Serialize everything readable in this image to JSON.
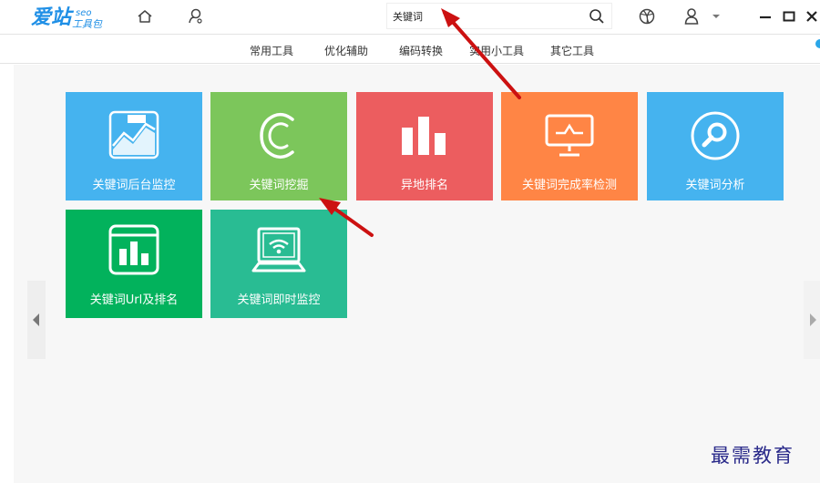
{
  "app": {
    "logo_main": "爱站",
    "logo_seo": "seo",
    "logo_tool": "工具包",
    "brand_color": "#1f8fe6"
  },
  "topbar": {
    "icons": [
      "home-icon",
      "user-location-icon",
      "basketball-icon",
      "user-icon",
      "chevron-down-icon",
      "minimize-icon",
      "maximize-icon",
      "close-icon"
    ],
    "search": {
      "value": "关键词",
      "placeholder": ""
    }
  },
  "nav": {
    "items": [
      "常用工具",
      "优化辅助",
      "编码转换",
      "实用小工具",
      "其它工具"
    ]
  },
  "tiles": [
    {
      "label": "关键词后台监控",
      "icon": "monitor-chart-icon",
      "color": "#45b3ef"
    },
    {
      "label": "关键词挖掘",
      "icon": "c-logo-icon",
      "color": "#7cc65b"
    },
    {
      "label": "异地排名",
      "icon": "bar-chart-icon",
      "color": "#ec5d5f"
    },
    {
      "label": "关键词完成率检测",
      "icon": "presentation-screen-icon",
      "color": "#ff8545"
    },
    {
      "label": "关键词分析",
      "icon": "magnifier-icon",
      "color": "#45b3ef"
    },
    {
      "label": "关键词Url及排名",
      "icon": "bar-chart-window-icon",
      "color": "#02b25c"
    },
    {
      "label": "关键词即时监控",
      "icon": "laptop-wifi-icon",
      "color": "#29bc93"
    }
  ],
  "watermark": "最需教育",
  "annotation_color": "#cc1111"
}
